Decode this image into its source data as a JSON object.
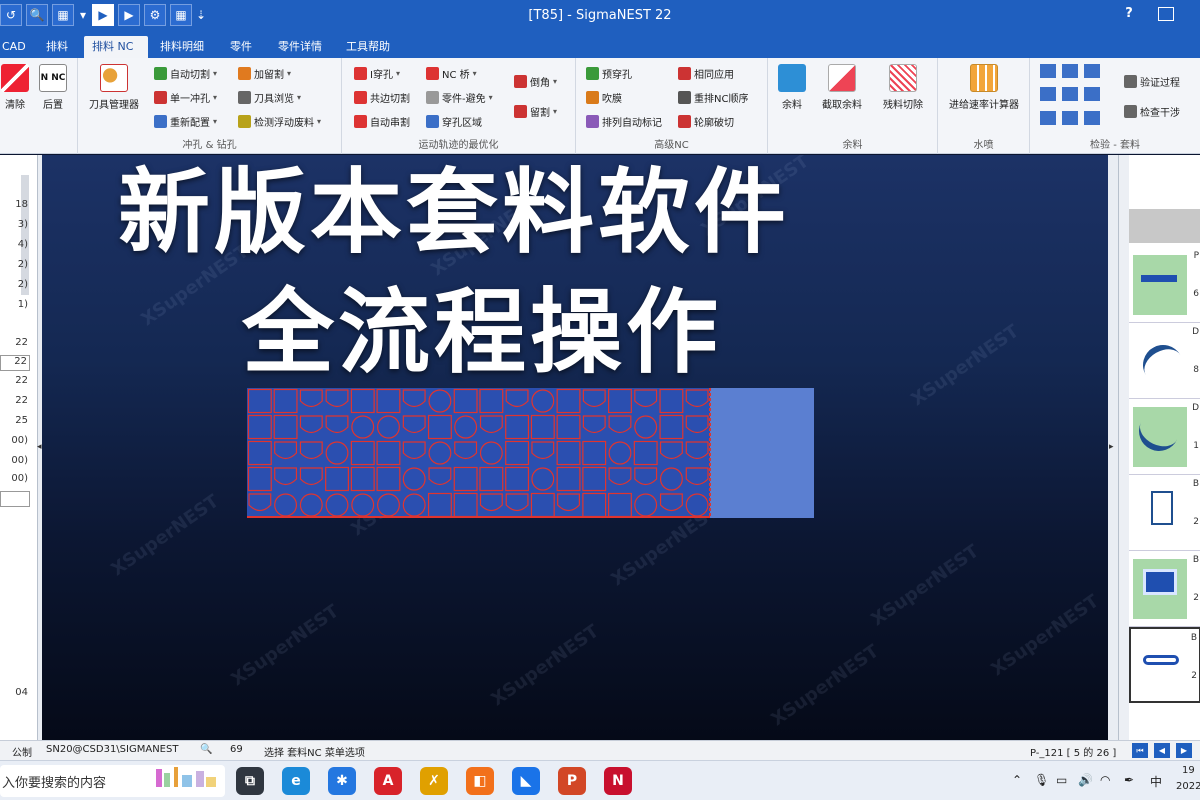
{
  "window": {
    "title": "[T85] - SigmaNEST 22",
    "help": "?",
    "restore": "▣"
  },
  "qat": [
    "↺",
    "🔍",
    "▦",
    "▾",
    "▶",
    "▶",
    "⚙",
    "▦",
    "⇣"
  ],
  "tabs": [
    "CAD",
    "排料",
    "排料 NC",
    "排料明细",
    "零件",
    "零件详情",
    "工具帮助"
  ],
  "active_tab": 2,
  "ribbon": {
    "left": {
      "clear_label": "清除",
      "post_label": "后置",
      "nnc_text": "N NC"
    },
    "punch_group": {
      "label": "冲孔 & 钻孔",
      "tool_manager": "刀具管理器",
      "items": [
        "自动切割",
        "单一冲孔",
        "重新配置",
        "加留割",
        "刀具浏览",
        "检测浮动废料"
      ]
    },
    "motion_group": {
      "label": "运动轨迹的最优化",
      "items": [
        "I穿孔",
        "共边切割",
        "自动串割",
        "NC 桥",
        "零件-避免",
        "穿孔区域",
        "倒角",
        "留割"
      ]
    },
    "advanced_group": {
      "label": "高级NC",
      "items": [
        "预穿孔",
        "吹膜",
        "排列自动标记",
        "相同应用",
        "重排NC顺序",
        "轮廓破切"
      ]
    },
    "remnant_group": {
      "label": "余料",
      "items": [
        "余料",
        "截取余料",
        "残料切除"
      ]
    },
    "water_group": {
      "label": "水喷",
      "items": [
        "进给速率计算器"
      ]
    },
    "check_group": {
      "label": "检验 - 套料",
      "items": [
        "验证过程",
        "检查干涉"
      ]
    }
  },
  "left_panel": {
    "rows": [
      "18",
      "3)",
      "4)",
      "2)",
      "2)",
      "1)",
      "",
      "22",
      "22",
      "22",
      "22",
      "25",
      "00)",
      "00)",
      "00)",
      "",
      "04"
    ]
  },
  "overlay": {
    "line1": "新版本套料软件",
    "line2": "全流程操作"
  },
  "watermark": "XSuperNEST",
  "right_panel": {
    "cards": [
      {
        "id": "P",
        "qty": "6"
      },
      {
        "id": "D",
        "qty": "8"
      },
      {
        "id": "D",
        "qty": "1"
      },
      {
        "id": "B",
        "qty": "2"
      },
      {
        "id": "B",
        "qty": "2"
      },
      {
        "id": "B",
        "qty": "2"
      }
    ]
  },
  "status": {
    "mode": "公制",
    "user": "SN20@CSD31\\SIGMANEST",
    "zoom": "69",
    "hint": "选择 套料NC 菜单选项",
    "page": "P-_121 [ 5 的 26 ]"
  },
  "taskbar": {
    "search_placeholder": "入你要搜索的内容",
    "apps": [
      {
        "icon": "task-view-icon",
        "glyph": "⧉",
        "color": "#2f3640"
      },
      {
        "icon": "edge-icon",
        "glyph": "e",
        "color": "#1b8ad8"
      },
      {
        "icon": "store-icon",
        "glyph": "✱",
        "color": "#2477e0"
      },
      {
        "icon": "acrobat-icon",
        "glyph": "A",
        "color": "#d8232a"
      },
      {
        "icon": "app-x-icon",
        "glyph": "✗",
        "color": "#e0a000"
      },
      {
        "icon": "app-orange-icon",
        "glyph": "◧",
        "color": "#f2701b"
      },
      {
        "icon": "app-blue-icon",
        "glyph": "◣",
        "color": "#1a73e8"
      },
      {
        "icon": "powerpoint-icon",
        "glyph": "P",
        "color": "#d24726"
      },
      {
        "icon": "sigmanest-icon",
        "glyph": "N",
        "color": "#c8102e"
      }
    ],
    "tray": {
      "ime": "中",
      "clock_top": "19",
      "clock_bottom": "2022"
    }
  },
  "colors": {
    "accent": "#1f5fbf",
    "sheet": "#5b7fd1",
    "parts": "#2b4fb0",
    "part_edge": "#e0342f"
  }
}
